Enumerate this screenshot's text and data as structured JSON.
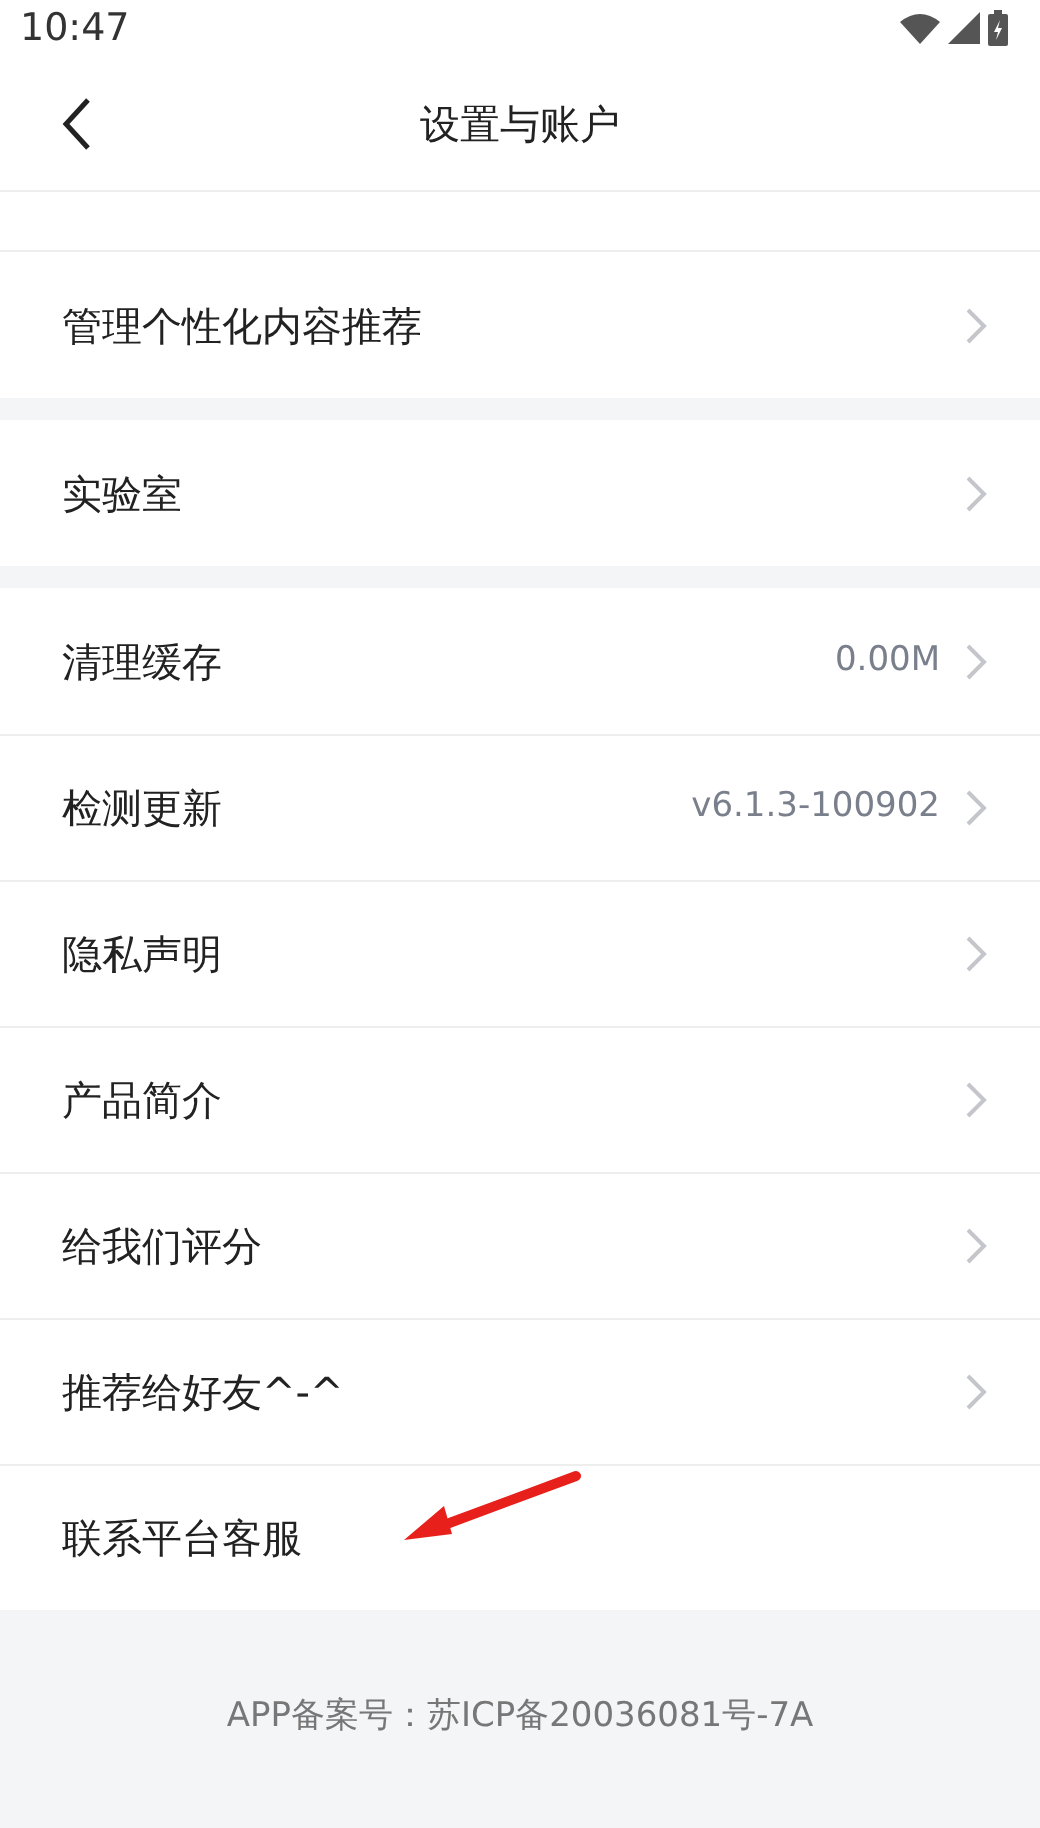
{
  "status_bar": {
    "time": "10:47"
  },
  "header": {
    "title": "设置与账户"
  },
  "sections": [
    {
      "rows": [
        {
          "label": "管理个性化内容推荐",
          "arrow": true
        }
      ]
    },
    {
      "rows": [
        {
          "label": "实验室",
          "arrow": true
        }
      ]
    },
    {
      "rows": [
        {
          "label": "清理缓存",
          "value": "0.00M",
          "arrow": true
        },
        {
          "label": "检测更新",
          "value": "v6.1.3-100902",
          "arrow": true
        },
        {
          "label": "隐私声明",
          "arrow": true
        },
        {
          "label": "产品简介",
          "arrow": true
        },
        {
          "label": "给我们评分",
          "arrow": true
        },
        {
          "label": "推荐给好友^-^",
          "arrow": true
        },
        {
          "label": "联系平台客服",
          "arrow": false
        }
      ]
    }
  ],
  "footer": {
    "text": "APP备案号：苏ICP备20036081号-7A"
  }
}
